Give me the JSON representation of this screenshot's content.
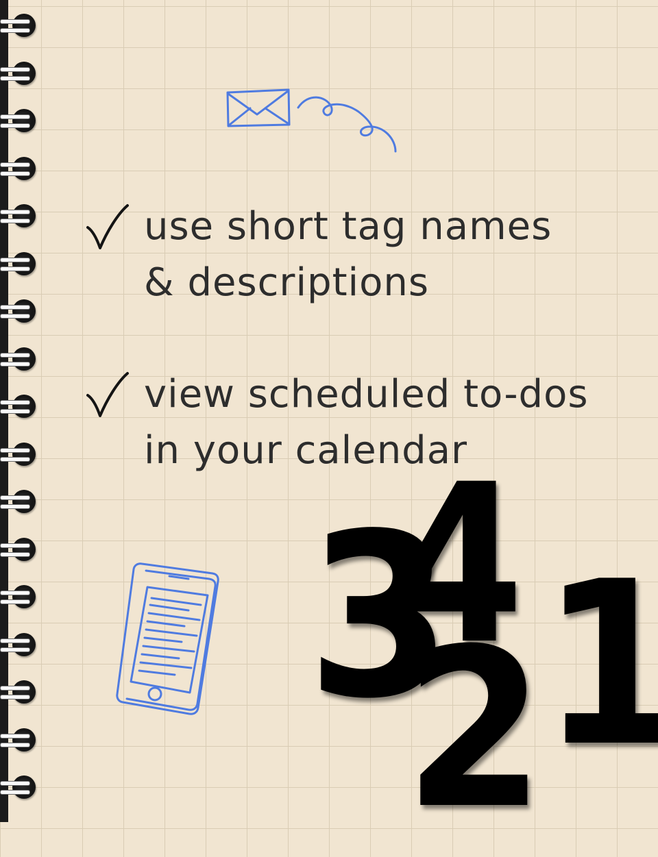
{
  "tasks": [
    {
      "line1": "use short tag names",
      "line2": "& descriptions"
    },
    {
      "line1": "view scheduled to-dos",
      "line2": "in your calendar"
    }
  ],
  "big_numbers": [
    "3",
    "4",
    "2",
    "1"
  ],
  "icons": {
    "check": "checkmark-icon",
    "envelope": "envelope-icon",
    "phone": "phone-icon"
  },
  "colors": {
    "paper": "#f1e5d1",
    "grid": "#d9ccb4",
    "ink": "#2d2d2d",
    "doodle_blue": "#4f7be0",
    "binding": "#1c1c1c"
  }
}
